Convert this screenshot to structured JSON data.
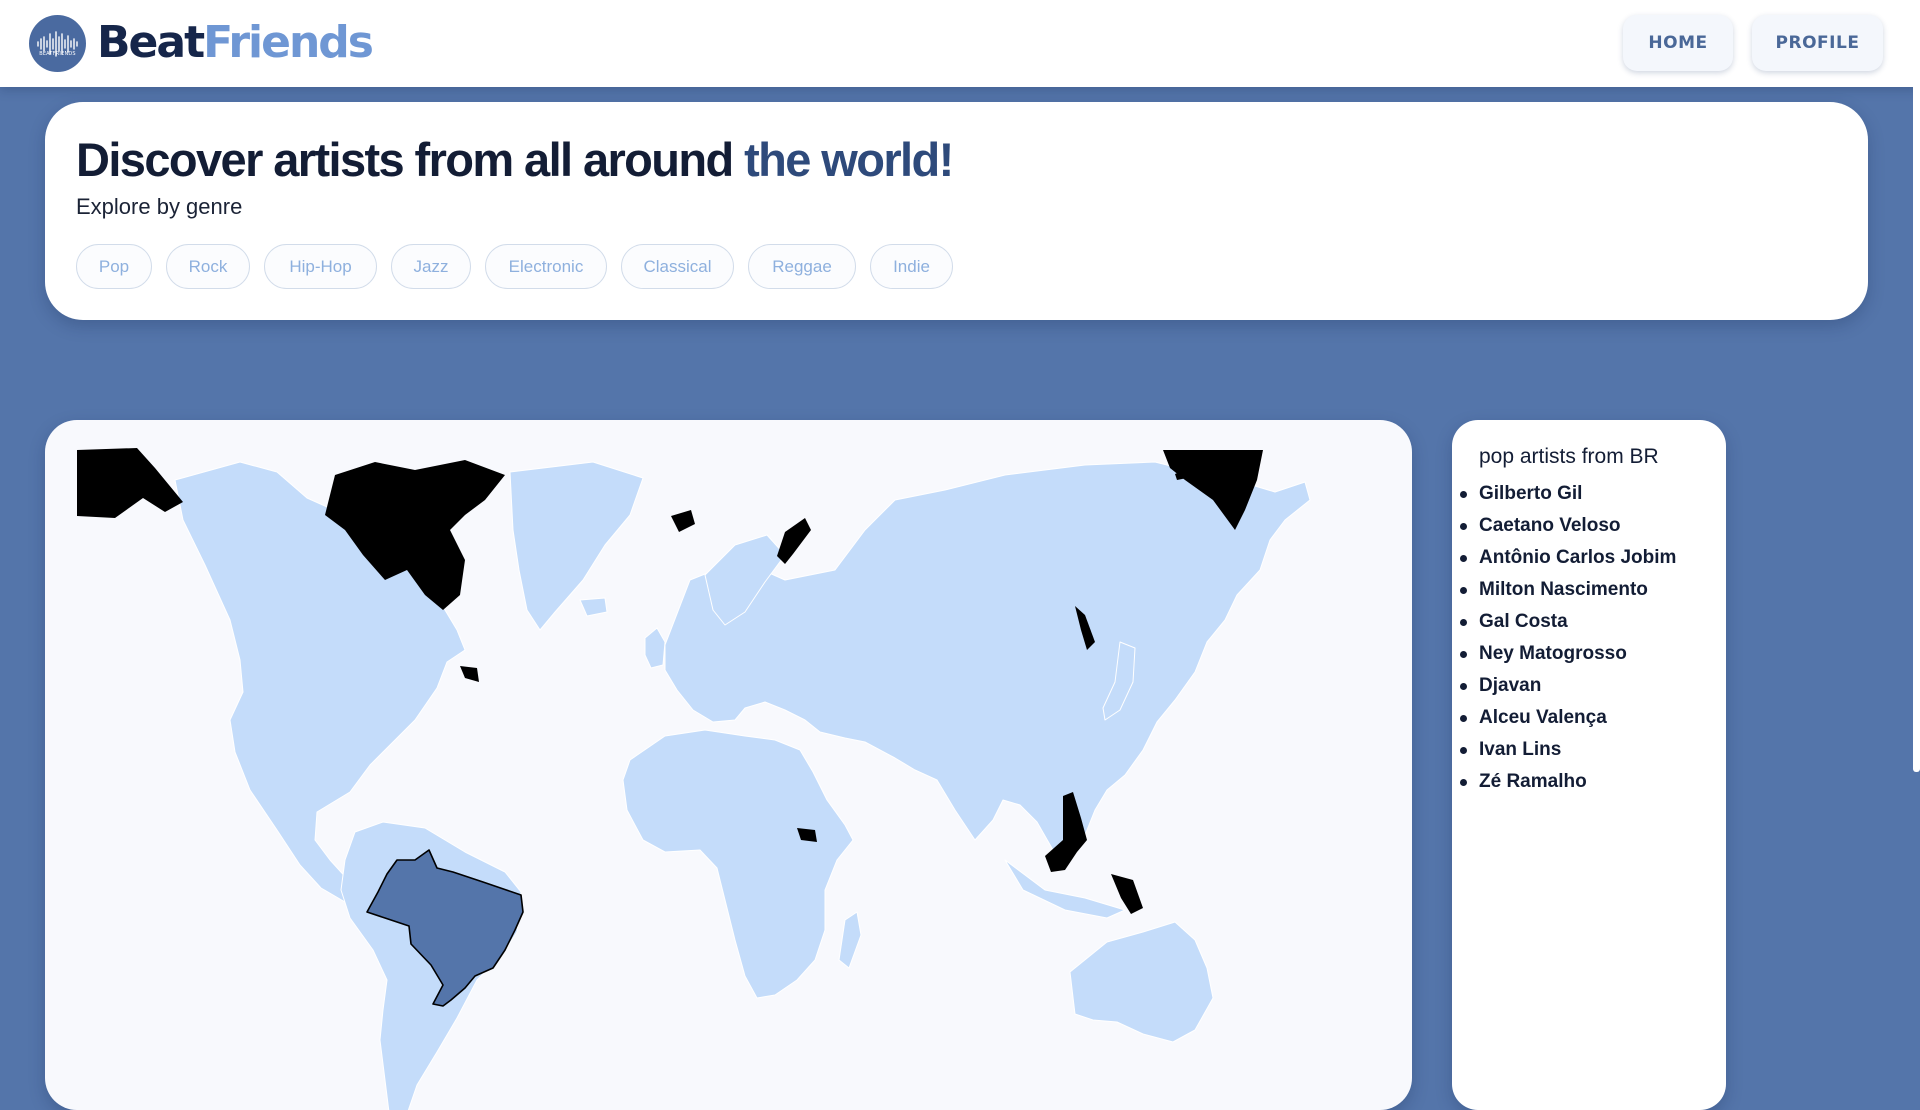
{
  "header": {
    "brand_part1": "Beat",
    "brand_part2": "Friends",
    "logo_text": "BEATFRIENDS",
    "nav": {
      "home": "HOME",
      "profile": "PROFILE"
    }
  },
  "hero": {
    "title_part1": "Discover artists from all around ",
    "title_part2": "the world!",
    "subtitle": "Explore by genre",
    "genres": [
      "Pop",
      "Rock",
      "Hip-Hop",
      "Jazz",
      "Electronic",
      "Classical",
      "Reggae",
      "Indie"
    ]
  },
  "map": {
    "selected_country": "BR",
    "colors": {
      "land": "#c4dcfa",
      "selected": "#5475aa",
      "no_data": "#000000",
      "border": "#ffffff"
    }
  },
  "artists": {
    "title": "pop artists from BR",
    "list": [
      "Gilberto Gil",
      "Caetano Veloso",
      "Antônio Carlos Jobim",
      "Milton Nascimento",
      "Gal Costa",
      "Ney Matogrosso",
      "Djavan",
      "Alceu Valença",
      "Ivan Lins",
      "Zé Ramalho"
    ]
  },
  "colors": {
    "page_bg": "#5475aa",
    "brand_dark": "#16264a",
    "brand_light": "#6f97d4",
    "chip_text": "#8eb0de"
  }
}
